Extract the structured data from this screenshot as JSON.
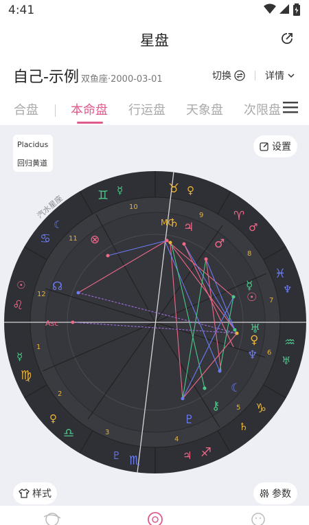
{
  "status": {
    "time": "4:41"
  },
  "header": {
    "title": "星盘"
  },
  "profile": {
    "name": "自己-示例",
    "sub": "双鱼座·2000-03-01",
    "switch_label": "切换",
    "detail_label": "详情"
  },
  "tabs": [
    {
      "label": "合盘"
    },
    {
      "label": "本命盘"
    },
    {
      "label": "行运盘"
    },
    {
      "label": "天象盘"
    },
    {
      "label": "次限盘"
    }
  ],
  "chart": {
    "house_system": "Placidus",
    "zodiac": "回归黄道",
    "settings_label": "设置",
    "style_label": "样式",
    "params_label": "参数",
    "watermark": "汽水星座",
    "asc_label": "Asc",
    "mc_label": "MC",
    "houses": [
      "1",
      "2",
      "3",
      "4",
      "5",
      "6",
      "7",
      "8",
      "9",
      "10",
      "11",
      "12"
    ]
  },
  "colors": {
    "accent": "#e05a8d",
    "wheel_outer": "#2e2e35",
    "wheel_inner": "#3a3a42",
    "wheel_center": "#34343c",
    "red": "#f06a88",
    "blue": "#6b7cf0",
    "green": "#4cc98a",
    "yellow": "#e8b43a"
  }
}
